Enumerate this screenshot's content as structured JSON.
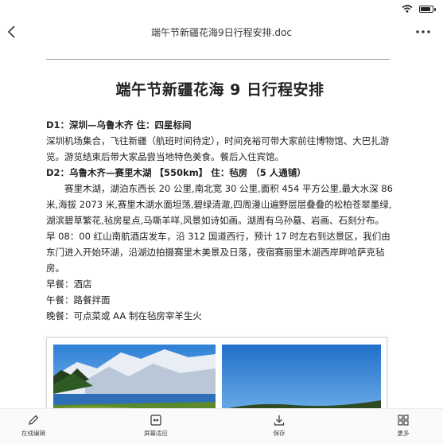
{
  "header": {
    "title": "端午节新疆花海9日行程安排.doc"
  },
  "doc": {
    "title": "端午节新疆花海 9 日行程安排",
    "d1_heading": "D1：深圳—乌鲁木齐      住：四星标间",
    "d1_body": "深圳机场集合，飞往新疆（航班时间待定），时间充裕可带大家前往博物馆、大巴扎游览。游览结束后带大家品尝当地特色美食。餐后入住宾馆。",
    "d2_heading": "D2：乌鲁木齐—赛里木湖 【550km】    住：毡房 （5 人通铺）",
    "d2_body": "赛里木湖，湖泊东西长 20 公里,南北宽 30 公里,面积 454 平方公里,最大水深 86 米,海拔 2073 米,赛里木湖水面坦荡,碧绿清澈,四周漫山遍野层层叠叠的松柏苍翠墨绿,湖滨碧草繁花,毡房星点,马嘶羊咩,风景如诗如画。湖周有乌孙墓、岩画、石刻分布。",
    "d2_schedule": "早 08：00 红山南航酒店发车，沿 312 国道西行，预计 17 时左右到达景区，我们由东门进入开始环湖，沿湖边拍摄赛里木美景及日落，夜宿赛丽里木湖西岸畔哈萨克毡房。",
    "breakfast": "早餐：酒店",
    "lunch": "午餐：路餐拌面",
    "dinner": "晚餐：可点菜或 AA 制在毡房宰羊生火"
  },
  "toolbar": {
    "edit": "在线编辑",
    "fit": "屏幕适应",
    "save": "保存",
    "more": "更多"
  }
}
